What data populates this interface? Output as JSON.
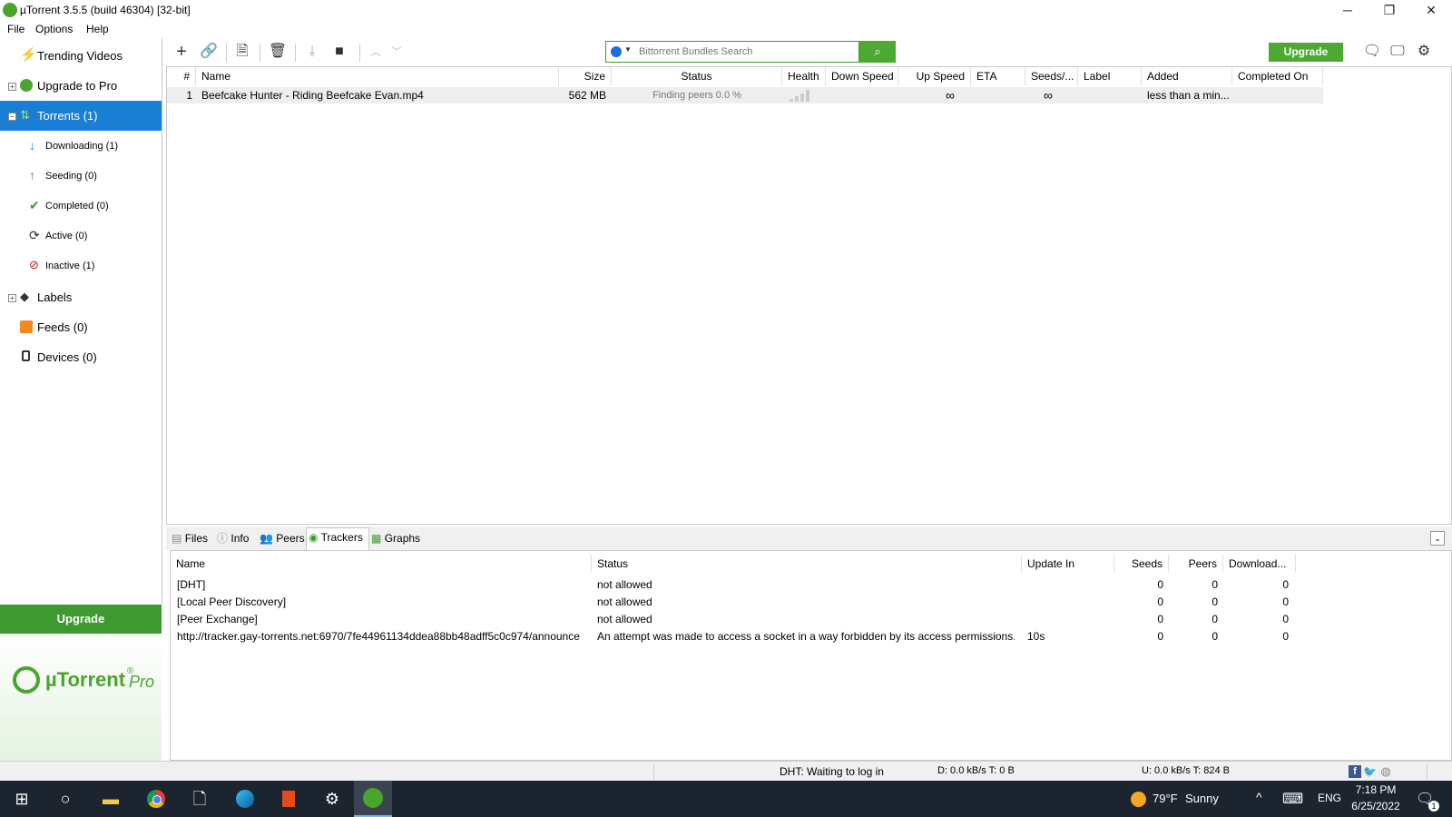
{
  "window": {
    "title": "µTorrent 3.5.5  (build 46304) [32-bit]",
    "controls": [
      "─",
      "❐",
      "✕"
    ]
  },
  "menu": [
    "File",
    "Options",
    "Help"
  ],
  "sidebar": {
    "items": [
      {
        "label": "Trending Videos"
      },
      {
        "label": "Upgrade to Pro"
      },
      {
        "label": "Torrents (1)"
      },
      {
        "label": "Downloading (1)"
      },
      {
        "label": "Seeding (0)"
      },
      {
        "label": "Completed (0)"
      },
      {
        "label": "Active (0)"
      },
      {
        "label": "Inactive (1)"
      },
      {
        "label": "Labels"
      },
      {
        "label": "Feeds (0)"
      },
      {
        "label": "Devices (0)"
      }
    ],
    "upgrade_label": "Upgrade",
    "promo_brand": "µTorrent",
    "promo_suffix": "Pro",
    "promo_reg": "®"
  },
  "toolbar": {
    "search_placeholder": "Bittorrent Bundles Search",
    "upgrade_label": "Upgrade"
  },
  "torrents": {
    "columns": [
      "#",
      "Name",
      "Size",
      "Status",
      "Health",
      "Down Speed",
      "Up Speed",
      "ETA",
      "Seeds/...",
      "Label",
      "Added",
      "Completed On"
    ],
    "rows": [
      {
        "num": "1",
        "name": "Beefcake Hunter - Riding Beefcake Evan.mp4",
        "size": "562 MB",
        "status": "Finding peers 0.0 %",
        "down_speed": "",
        "up_speed": "",
        "eta": "∞",
        "seeds": "∞",
        "label": "",
        "added": "less than a min...",
        "completed": ""
      }
    ]
  },
  "detail_tabs": [
    "Files",
    "Info",
    "Peers",
    "Trackers",
    "Graphs"
  ],
  "trackers": {
    "columns": [
      "Name",
      "Status",
      "Update In",
      "Seeds",
      "Peers",
      "Download..."
    ],
    "rows": [
      {
        "name": "[DHT]",
        "status": "not allowed",
        "update": "",
        "seeds": "0",
        "peers": "0",
        "download": "0"
      },
      {
        "name": "[Local Peer Discovery]",
        "status": "not allowed",
        "update": "",
        "seeds": "0",
        "peers": "0",
        "download": "0"
      },
      {
        "name": "[Peer Exchange]",
        "status": "not allowed",
        "update": "",
        "seeds": "0",
        "peers": "0",
        "download": "0"
      },
      {
        "name": "http://tracker.gay-torrents.net:6970/7fe44961134ddea88bb48adff5c0c974/announce",
        "status": "An attempt was made to access a socket in a way forbidden by its access permissions.",
        "update": "10s",
        "seeds": "0",
        "peers": "0",
        "download": "0"
      }
    ]
  },
  "statusbar": {
    "dht": "DHT: Waiting to log in",
    "down": "D: 0.0 kB/s T: 0 B",
    "up": "U: 0.0 kB/s T: 824 B"
  },
  "taskbar": {
    "weather_temp": "79°F",
    "weather_desc": "Sunny",
    "lang": "ENG",
    "time": "7:18 PM",
    "date": "6/25/2022",
    "notif_count": "1"
  },
  "colors": {
    "accent_green": "#4caa32",
    "selection_blue": "#1a7fd4",
    "taskbar": "#1c2430"
  }
}
